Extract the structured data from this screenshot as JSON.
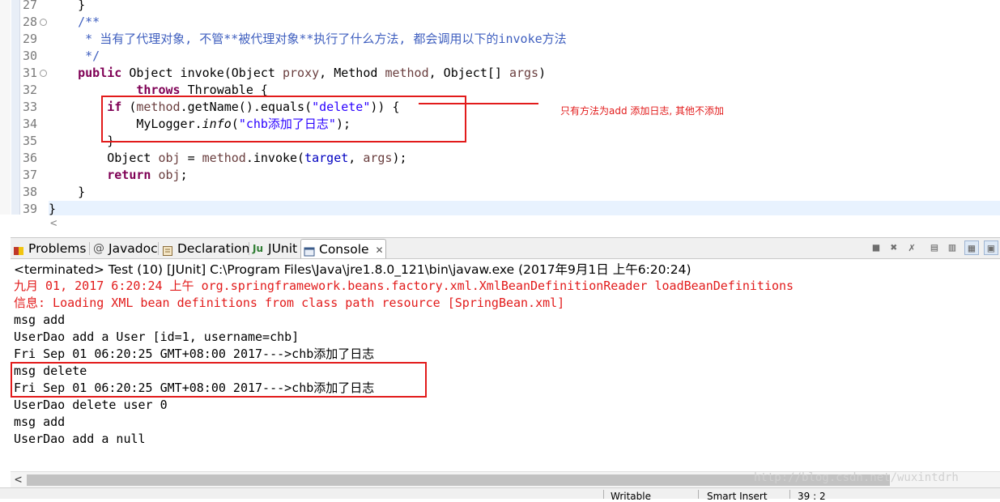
{
  "editor": {
    "line_numbers": [
      "27",
      "28",
      "29",
      "30",
      "31",
      "32",
      "33",
      "34",
      "35",
      "36",
      "37",
      "38",
      "39"
    ],
    "lines": [
      [
        {
          "t": "    }",
          "c": "txt"
        }
      ],
      [
        {
          "t": "    /**",
          "c": "cm"
        }
      ],
      [
        {
          "t": "     * 当有了代理对象, 不管**被代理对象**执行了什么方法, 都会调用以下的invoke方法",
          "c": "cm"
        }
      ],
      [
        {
          "t": "     */",
          "c": "cm"
        }
      ],
      [
        {
          "t": "    ",
          "c": "txt"
        },
        {
          "t": "public",
          "c": "kw"
        },
        {
          "t": " Object invoke(Object ",
          "c": "txt"
        },
        {
          "t": "proxy",
          "c": "var"
        },
        {
          "t": ", Method ",
          "c": "txt"
        },
        {
          "t": "method",
          "c": "var"
        },
        {
          "t": ", Object[] ",
          "c": "txt"
        },
        {
          "t": "args",
          "c": "var"
        },
        {
          "t": ")",
          "c": "txt"
        }
      ],
      [
        {
          "t": "            ",
          "c": "txt"
        },
        {
          "t": "throws",
          "c": "kw"
        },
        {
          "t": " Throwable {",
          "c": "txt"
        }
      ],
      [
        {
          "t": "        ",
          "c": "txt"
        },
        {
          "t": "if",
          "c": "kw"
        },
        {
          "t": " (",
          "c": "txt"
        },
        {
          "t": "method",
          "c": "var"
        },
        {
          "t": ".getName().equals(",
          "c": "txt"
        },
        {
          "t": "\"delete\"",
          "c": "str"
        },
        {
          "t": ")) {",
          "c": "txt"
        }
      ],
      [
        {
          "t": "            MyLogger.",
          "c": "txt"
        },
        {
          "t": "info",
          "c": "ital"
        },
        {
          "t": "(",
          "c": "txt"
        },
        {
          "t": "\"chb添加了日志\"",
          "c": "str"
        },
        {
          "t": ");",
          "c": "txt"
        }
      ],
      [
        {
          "t": "        }",
          "c": "txt"
        }
      ],
      [
        {
          "t": "        Object ",
          "c": "txt"
        },
        {
          "t": "obj",
          "c": "var"
        },
        {
          "t": " = ",
          "c": "txt"
        },
        {
          "t": "method",
          "c": "var"
        },
        {
          "t": ".invoke(",
          "c": "txt"
        },
        {
          "t": "target",
          "c": "fld"
        },
        {
          "t": ", ",
          "c": "txt"
        },
        {
          "t": "args",
          "c": "var"
        },
        {
          "t": ");",
          "c": "txt"
        }
      ],
      [
        {
          "t": "        ",
          "c": "txt"
        },
        {
          "t": "return",
          "c": "kw"
        },
        {
          "t": " ",
          "c": "txt"
        },
        {
          "t": "obj",
          "c": "var"
        },
        {
          "t": ";",
          "c": "txt"
        }
      ],
      [
        {
          "t": "    }",
          "c": "txt"
        }
      ],
      [
        {
          "t": "}",
          "c": "txt"
        }
      ]
    ],
    "annotation_note": "只有方法为add 添加日志, 其他不添加"
  },
  "tabs": [
    {
      "label": "Problems",
      "icon": "problems-icon",
      "color": "#c0392b"
    },
    {
      "label": "Javadoc",
      "icon": "at-icon",
      "color": "#555555"
    },
    {
      "label": "Declaration",
      "icon": "declaration-icon",
      "color": "#8a6d3b"
    },
    {
      "label": "JUnit",
      "icon": "junit-icon",
      "color": "#2e7d32"
    },
    {
      "label": "Console",
      "icon": "console-icon",
      "color": "#3b5b8a",
      "active": true
    }
  ],
  "console": {
    "terminated_line": "<terminated> Test (10) [JUnit] C:\\Program Files\\Java\\jre1.8.0_121\\bin\\javaw.exe (2017年9月1日 上午6:20:24)",
    "output": [
      {
        "text": "九月 01, 2017 6:20:24 上午 org.springframework.beans.factory.xml.XmlBeanDefinitionReader loadBeanDefinitions",
        "err": true
      },
      {
        "text": "信息: Loading XML bean definitions from class path resource [SpringBean.xml]",
        "err": true
      },
      {
        "text": "msg add",
        "err": false
      },
      {
        "text": "UserDao add a User [id=1, username=chb]",
        "err": false
      },
      {
        "text": "Fri Sep 01 06:20:25 GMT+08:00 2017--->chb添加了日志",
        "err": false
      },
      {
        "text": "msg delete",
        "err": false
      },
      {
        "text": "Fri Sep 01 06:20:25 GMT+08:00 2017--->chb添加了日志",
        "err": false
      },
      {
        "text": "UserDao delete user 0",
        "err": false
      },
      {
        "text": "msg add",
        "err": false
      },
      {
        "text": "UserDao add a null",
        "err": false
      }
    ]
  },
  "watermark": "http://blog.csdn.net/wuxintdrh",
  "status": {
    "writable": "Writable",
    "insert_mode": "Smart Insert",
    "position": "39 : 2"
  },
  "colors": {
    "annotation_red": "#e21b1b",
    "keyword": "#7f0055",
    "comment": "#3f5fbf",
    "string": "#2a00ff"
  }
}
